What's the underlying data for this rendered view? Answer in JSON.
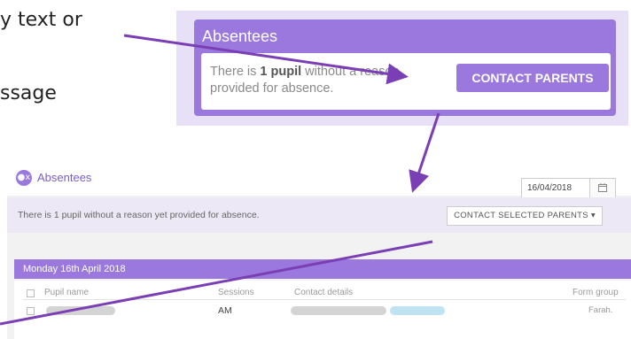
{
  "instructions": {
    "fragment_1": "y text or",
    "fragment_2": "ssage"
  },
  "callout": {
    "title": "Absentees",
    "text_prefix": "There is ",
    "text_bold": "1 pupil",
    "text_suffix": " without a reason provided for absence.",
    "button": "CONTACT PARENTS"
  },
  "panel": {
    "title": "Absentees",
    "date": "16/04/2018",
    "notice": "There is 1 pupil without a reason yet provided for absence.",
    "contact_selected_button": "CONTACT SELECTED PARENTS",
    "day_label": "Monday 16th April 2018",
    "columns": {
      "pupil_name": "Pupil name",
      "sessions": "Sessions",
      "contact_details": "Contact details",
      "form_group": "Form group"
    },
    "rows": [
      {
        "sessions": "AM",
        "form_group": "Farah."
      }
    ]
  },
  "colors": {
    "accent": "#9a78de",
    "annotation_arrow": "#7a3fb5"
  }
}
